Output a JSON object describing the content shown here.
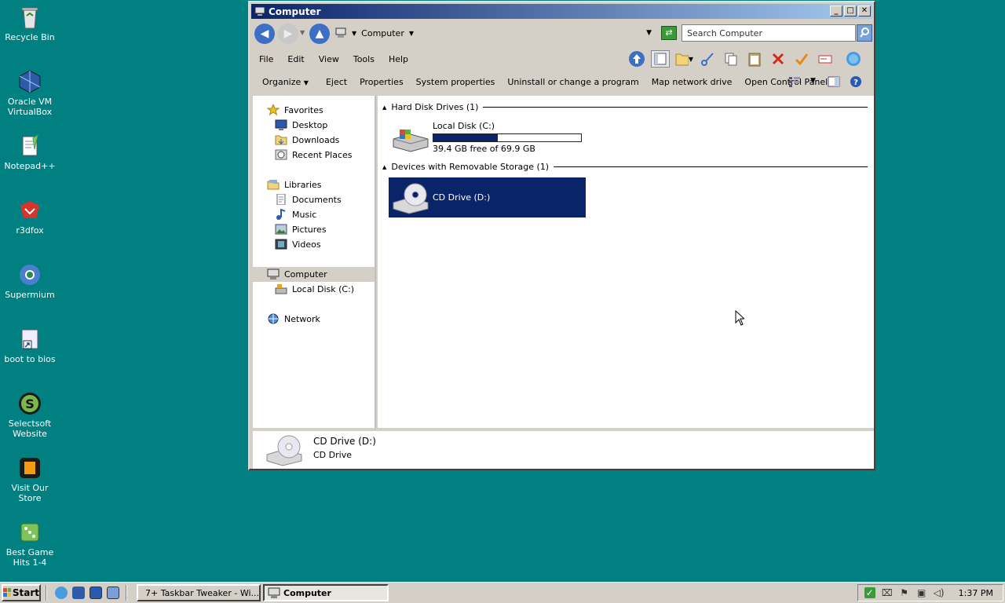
{
  "desktop": {
    "icons": [
      {
        "label": "Recycle Bin",
        "icon": "recycle-bin-icon"
      },
      {
        "label": "Oracle VM\nVirtualBox",
        "icon": "virtualbox-icon"
      },
      {
        "label": "Notepad++",
        "icon": "notepad-plus-plus-icon"
      },
      {
        "label": "r3dfox",
        "icon": "r3dfox-icon"
      },
      {
        "label": "Supermium",
        "icon": "supermium-icon"
      },
      {
        "label": "boot to bios",
        "icon": "shortcut-icon"
      },
      {
        "label": "Selectsoft\nWebsite",
        "icon": "selectsoft-icon"
      },
      {
        "label": "Visit Our Store",
        "icon": "store-icon"
      },
      {
        "label": "Best Game\nHits 1-4",
        "icon": "game-icon"
      }
    ]
  },
  "window": {
    "title": "Computer",
    "address": {
      "path": "Computer",
      "search_placeholder": "Search Computer"
    },
    "menu": [
      "File",
      "Edit",
      "View",
      "Tools",
      "Help"
    ],
    "commands": [
      "Organize",
      "Eject",
      "Properties",
      "System properties",
      "Uninstall or change a program",
      "Map network drive",
      "Open Control Panel"
    ],
    "nav": {
      "favorites": {
        "label": "Favorites",
        "items": [
          "Desktop",
          "Downloads",
          "Recent Places"
        ]
      },
      "libraries": {
        "label": "Libraries",
        "items": [
          "Documents",
          "Music",
          "Pictures",
          "Videos"
        ]
      },
      "computer": {
        "label": "Computer",
        "items": [
          "Local Disk (C:)"
        ]
      },
      "network": {
        "label": "Network"
      }
    },
    "content": {
      "hdd_group": "Hard Disk Drives (1)",
      "removable_group": "Devices with Removable Storage (1)",
      "local_disk": {
        "name": "Local Disk (C:)",
        "free_text": "39.4 GB free of 69.9 GB",
        "used_fraction": 0.436
      },
      "cd_drive": {
        "name": "CD Drive (D:)"
      }
    },
    "details": {
      "name": "CD Drive (D:)",
      "type": "CD Drive"
    }
  },
  "taskbar": {
    "start_label": "Start",
    "tasks": [
      "7+ Taskbar Tweaker - Wi...",
      "Computer"
    ],
    "clock": "1:37 PM"
  },
  "colors": {
    "desktop": "#008080",
    "title_start": "#0a246a",
    "title_end": "#a6caf0",
    "selection": "#0a246a",
    "capacity_bar": "#0a246a"
  }
}
